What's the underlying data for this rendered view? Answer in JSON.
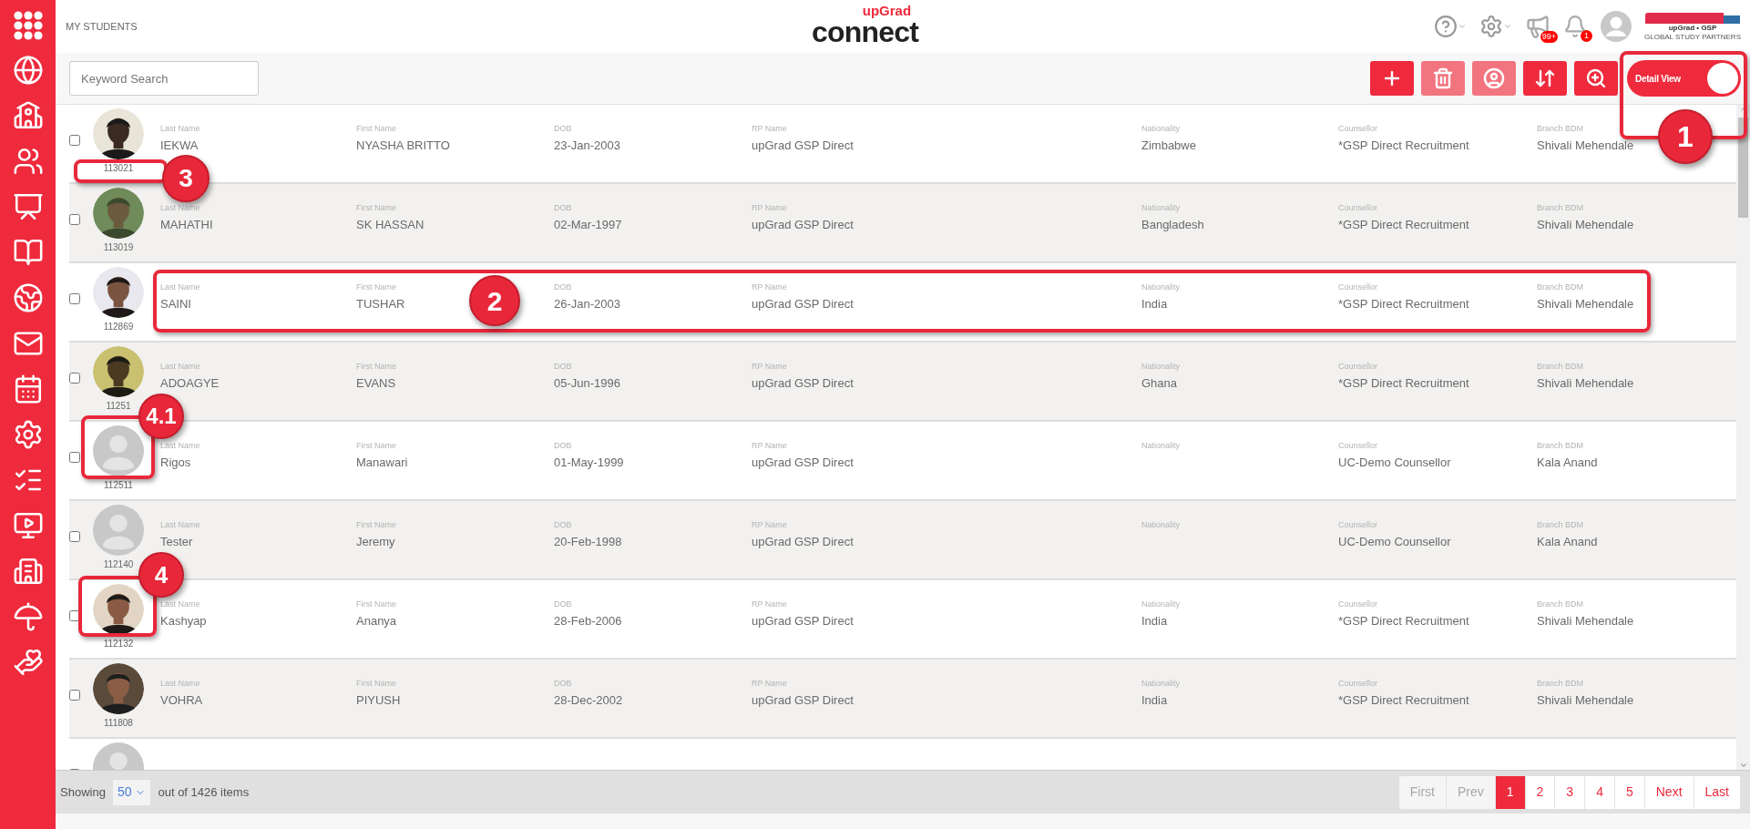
{
  "header": {
    "page_title": "MY STUDENTS",
    "logo_top": "upGrad",
    "logo_main": "connect",
    "announcement_count": "99+",
    "notification_count": "1",
    "partner_logo": "upGrad • GSP",
    "partner_tagline": "GLOBAL STUDY PARTNERS"
  },
  "toolbar": {
    "search": {
      "placeholder": "Keyword Search"
    },
    "buttons": [
      {
        "kind": "add",
        "disabled": false
      },
      {
        "kind": "delete",
        "disabled": true
      },
      {
        "kind": "assign",
        "disabled": true
      },
      {
        "kind": "sort",
        "disabled": false
      },
      {
        "kind": "zoom",
        "disabled": false
      }
    ],
    "view_toggle": {
      "label": "Detail View",
      "on": true
    }
  },
  "rows": [
    {
      "id": "113021",
      "checked": false,
      "fields": [
        {
          "label": "Last Name",
          "value": "IEKWA"
        },
        {
          "label": "First Name",
          "value": "NYASHA BRITTO"
        },
        {
          "label": "DOB",
          "value": "23-Jan-2003"
        },
        {
          "label": "RP Name",
          "value": "upGrad GSP Direct"
        },
        {
          "label": "Nationality",
          "value": "Zimbabwe"
        },
        {
          "label": "Counsellor",
          "value": "*GSP Direct Recruitment"
        },
        {
          "label": "Branch BDM",
          "value": "Shivali Mehendale"
        }
      ]
    },
    {
      "id": "113019",
      "checked": false,
      "fields": [
        {
          "label": "Last Name",
          "value": "MAHATHI"
        },
        {
          "label": "First Name",
          "value": "SK HASSAN"
        },
        {
          "label": "DOB",
          "value": "02-Mar-1997"
        },
        {
          "label": "RP Name",
          "value": "upGrad GSP Direct"
        },
        {
          "label": "Nationality",
          "value": "Bangladesh"
        },
        {
          "label": "Counsellor",
          "value": "*GSP Direct Recruitment"
        },
        {
          "label": "Branch BDM",
          "value": "Shivali Mehendale"
        }
      ]
    },
    {
      "id": "112869",
      "checked": false,
      "fields": [
        {
          "label": "Last Name",
          "value": "SAINI"
        },
        {
          "label": "First Name",
          "value": "TUSHAR"
        },
        {
          "label": "DOB",
          "value": "26-Jan-2003"
        },
        {
          "label": "RP Name",
          "value": "upGrad GSP Direct"
        },
        {
          "label": "Nationality",
          "value": "India"
        },
        {
          "label": "Counsellor",
          "value": "*GSP Direct Recruitment"
        },
        {
          "label": "Branch BDM",
          "value": "Shivali Mehendale"
        }
      ]
    },
    {
      "id": "11251",
      "checked": false,
      "fields": [
        {
          "label": "Last Name",
          "value": "ADOAGYE"
        },
        {
          "label": "First Name",
          "value": "EVANS"
        },
        {
          "label": "DOB",
          "value": "05-Jun-1996"
        },
        {
          "label": "RP Name",
          "value": "upGrad GSP Direct"
        },
        {
          "label": "Nationality",
          "value": "Ghana"
        },
        {
          "label": "Counsellor",
          "value": "*GSP Direct Recruitment"
        },
        {
          "label": "Branch BDM",
          "value": "Shivali Mehendale"
        }
      ]
    },
    {
      "id": "112511",
      "avatar": {
        "kind": "default"
      },
      "checked": false,
      "fields": [
        {
          "label": "Last Name",
          "value": "Rigos"
        },
        {
          "label": "First Name",
          "value": "Manawari"
        },
        {
          "label": "DOB",
          "value": "01-May-1999"
        },
        {
          "label": "RP Name",
          "value": "upGrad GSP Direct"
        },
        {
          "label": "Nationality"
        },
        {
          "label": "Counsellor",
          "value": "UC-Demo Counsellor"
        },
        {
          "label": "Branch BDM",
          "value": "Kala Anand"
        }
      ]
    },
    {
      "id": "112140",
      "avatar": {
        "kind": "default"
      },
      "checked": false,
      "fields": [
        {
          "label": "Last Name",
          "value": "Tester"
        },
        {
          "label": "First Name",
          "value": "Jeremy"
        },
        {
          "label": "DOB",
          "value": "20-Feb-1998"
        },
        {
          "label": "RP Name",
          "value": "upGrad GSP Direct"
        },
        {
          "label": "Nationality"
        },
        {
          "label": "Counsellor",
          "value": "UC-Demo Counsellor"
        },
        {
          "label": "Branch BDM",
          "value": "Kala Anand"
        }
      ]
    },
    {
      "id": "112132",
      "checked": false,
      "fields": [
        {
          "label": "Last Name",
          "value": "Kashyap"
        },
        {
          "label": "First Name",
          "value": "Ananya"
        },
        {
          "label": "DOB",
          "value": "28-Feb-2006"
        },
        {
          "label": "RP Name",
          "value": "upGrad GSP Direct"
        },
        {
          "label": "Nationality",
          "value": "India"
        },
        {
          "label": "Counsellor",
          "value": "*GSP Direct Recruitment"
        },
        {
          "label": "Branch BDM",
          "value": "Shivali Mehendale"
        }
      ]
    },
    {
      "id": "111808",
      "checked": false,
      "fields": [
        {
          "label": "Last Name",
          "value": "VOHRA"
        },
        {
          "label": "First Name",
          "value": "PIYUSH"
        },
        {
          "label": "DOB",
          "value": "28-Dec-2002"
        },
        {
          "label": "RP Name",
          "value": "upGrad GSP Direct"
        },
        {
          "label": "Nationality",
          "value": "India"
        },
        {
          "label": "Counsellor",
          "value": "*GSP Direct Recruitment"
        },
        {
          "label": "Branch BDM",
          "value": "Shivali Mehendale"
        }
      ]
    },
    {
      "avatar": {
        "kind": "default"
      },
      "checked": false,
      "fields": []
    }
  ],
  "footer": {
    "showing_label": "Showing",
    "page_size": "50",
    "total": "out of 1426 items",
    "pages": [
      {
        "label": "First",
        "disabled": true,
        "selected": false
      },
      {
        "label": "Prev",
        "disabled": true,
        "selected": false
      },
      {
        "label": "1",
        "disabled": false,
        "selected": true
      },
      {
        "label": "2",
        "disabled": false,
        "selected": false
      },
      {
        "label": "3",
        "disabled": false,
        "selected": false
      },
      {
        "label": "4",
        "disabled": false,
        "selected": false
      },
      {
        "label": "5",
        "disabled": false,
        "selected": false
      },
      {
        "label": "Next",
        "disabled": false,
        "selected": false
      },
      {
        "label": "Last",
        "disabled": false,
        "selected": false
      }
    ]
  },
  "callouts": [
    {
      "number": "1"
    },
    {
      "number": "2"
    },
    {
      "number": "3"
    },
    {
      "number": "4.1"
    },
    {
      "number": "4"
    }
  ]
}
